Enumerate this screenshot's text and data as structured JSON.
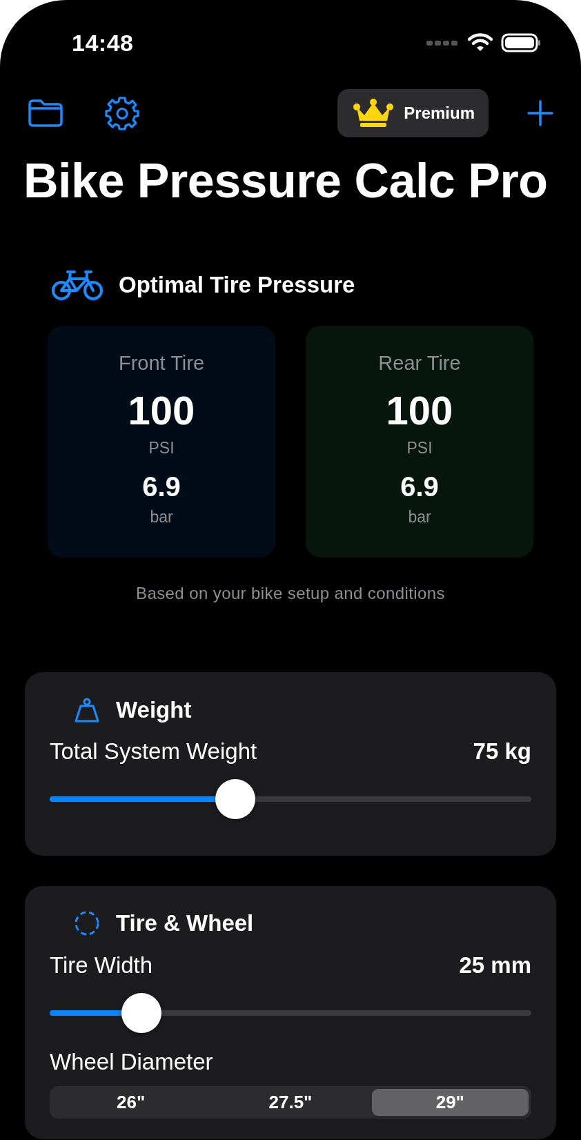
{
  "status_bar": {
    "time": "14:48"
  },
  "toolbar": {
    "premium_label": "Premium"
  },
  "title": "Bike Pressure Calc Pro",
  "result": {
    "heading": "Optimal Tire Pressure",
    "tires": [
      {
        "kind": "front",
        "label": "Front Tire",
        "psi": "100",
        "psi_unit": "PSI",
        "bar": "6.9",
        "bar_unit": "bar"
      },
      {
        "kind": "rear",
        "label": "Rear Tire",
        "psi": "100",
        "psi_unit": "PSI",
        "bar": "6.9",
        "bar_unit": "bar"
      }
    ],
    "note": "Based on your bike setup and conditions"
  },
  "sections": [
    {
      "kind": "weight",
      "title": "Weight",
      "sliders": [
        {
          "label": "Total System Weight",
          "reading": "75 kg",
          "level": 0.385
        }
      ]
    },
    {
      "kind": "tire",
      "title": "Tire & Wheel",
      "sliders": [
        {
          "label": "Tire Width",
          "reading": "25 mm",
          "level": 0.19
        }
      ],
      "segment_label": "Wheel Diameter",
      "segments": [
        {
          "label": "26\"",
          "selected": false
        },
        {
          "label": "27.5\"",
          "selected": false
        },
        {
          "label": "29\"",
          "selected": true
        }
      ]
    }
  ]
}
